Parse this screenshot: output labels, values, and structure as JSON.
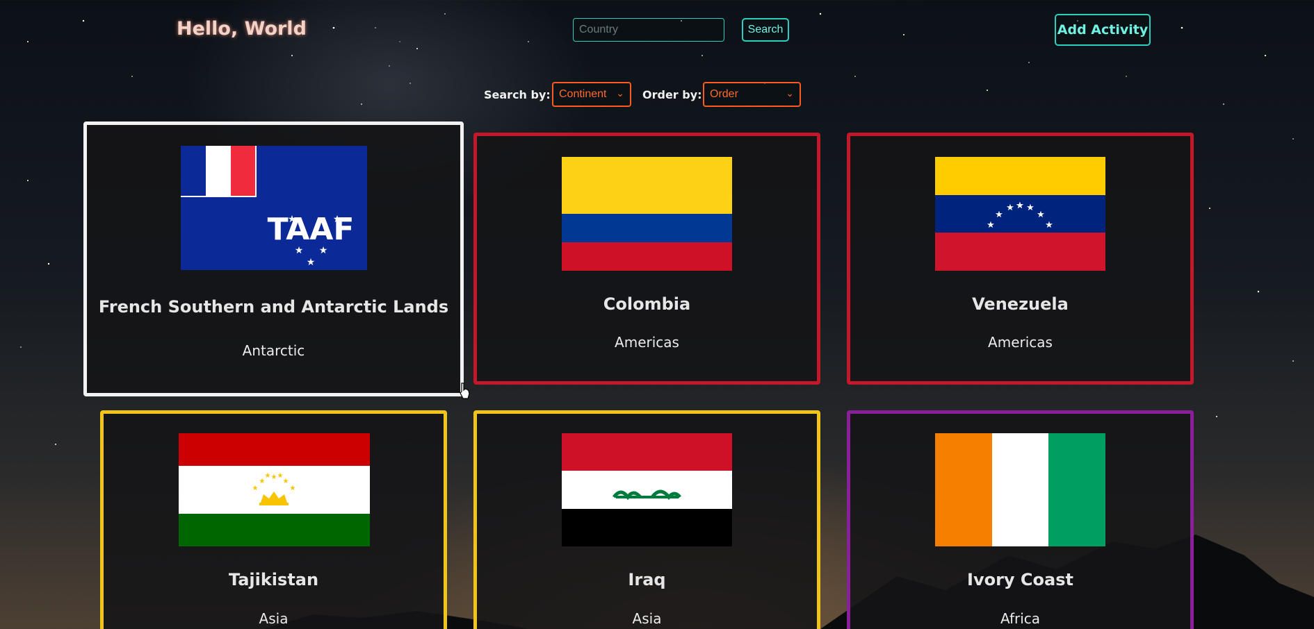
{
  "header": {
    "greeting": "Hello, World",
    "search_placeholder": "Country",
    "search_button": "Search",
    "add_activity_button": "Add Activity"
  },
  "filters": {
    "search_by_label": "Search by:",
    "search_by_value": "Continent",
    "order_by_label": "Order by:",
    "order_by_value": "Order"
  },
  "cards": [
    {
      "name": "French Southern and Antarctic Lands",
      "continent": "Antarctic",
      "flag": "french-southern-lands-flag",
      "border": "#f2f2f2"
    },
    {
      "name": "Colombia",
      "continent": "Americas",
      "flag": "colombia-flag",
      "border": "#c21829"
    },
    {
      "name": "Venezuela",
      "continent": "Americas",
      "flag": "venezuela-flag",
      "border": "#c21829"
    },
    {
      "name": "Tajikistan",
      "continent": "Asia",
      "flag": "tajikistan-flag",
      "border": "#f0c419"
    },
    {
      "name": "Iraq",
      "continent": "Asia",
      "flag": "iraq-flag",
      "border": "#f0c419"
    },
    {
      "name": "Ivory Coast",
      "continent": "Africa",
      "flag": "ivory-coast-flag",
      "border": "#8a1f9a"
    }
  ],
  "colors": {
    "accent_teal": "#2bd1c0",
    "accent_orange": "#ff5a1f"
  }
}
